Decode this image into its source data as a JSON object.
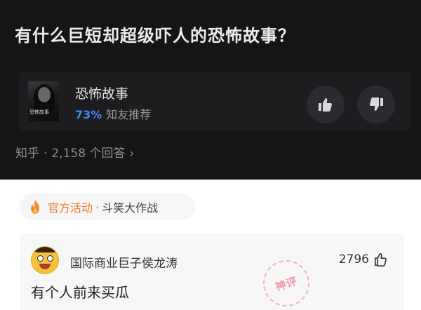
{
  "question": {
    "title": "有什么巨短却超级吓人的恐怖故事？"
  },
  "film": {
    "poster_text": "恐怖故事",
    "name": "恐怖故事",
    "recommend_pct": "73%",
    "recommend_label": "知友推荐",
    "upvote_icon": "thumbs-up-icon",
    "downvote_icon": "thumbs-down-icon"
  },
  "meta": {
    "source": "知乎",
    "separator": "·",
    "answers": "2,158 个回答",
    "chevron": "›"
  },
  "event": {
    "tag": "官方活动",
    "separator": "·",
    "name": "斗笑大作战"
  },
  "comment": {
    "author": "国际商业巨子侯龙涛",
    "likes": "2796",
    "stamp": "神评",
    "text": "有个人前来买瓜"
  },
  "colors": {
    "dark_bg": "#151517",
    "card_bg": "#1d1d20",
    "accent_blue": "#3d8bf0",
    "event_orange": "#f07a2d",
    "stamp_pink": "#ec6e87"
  }
}
